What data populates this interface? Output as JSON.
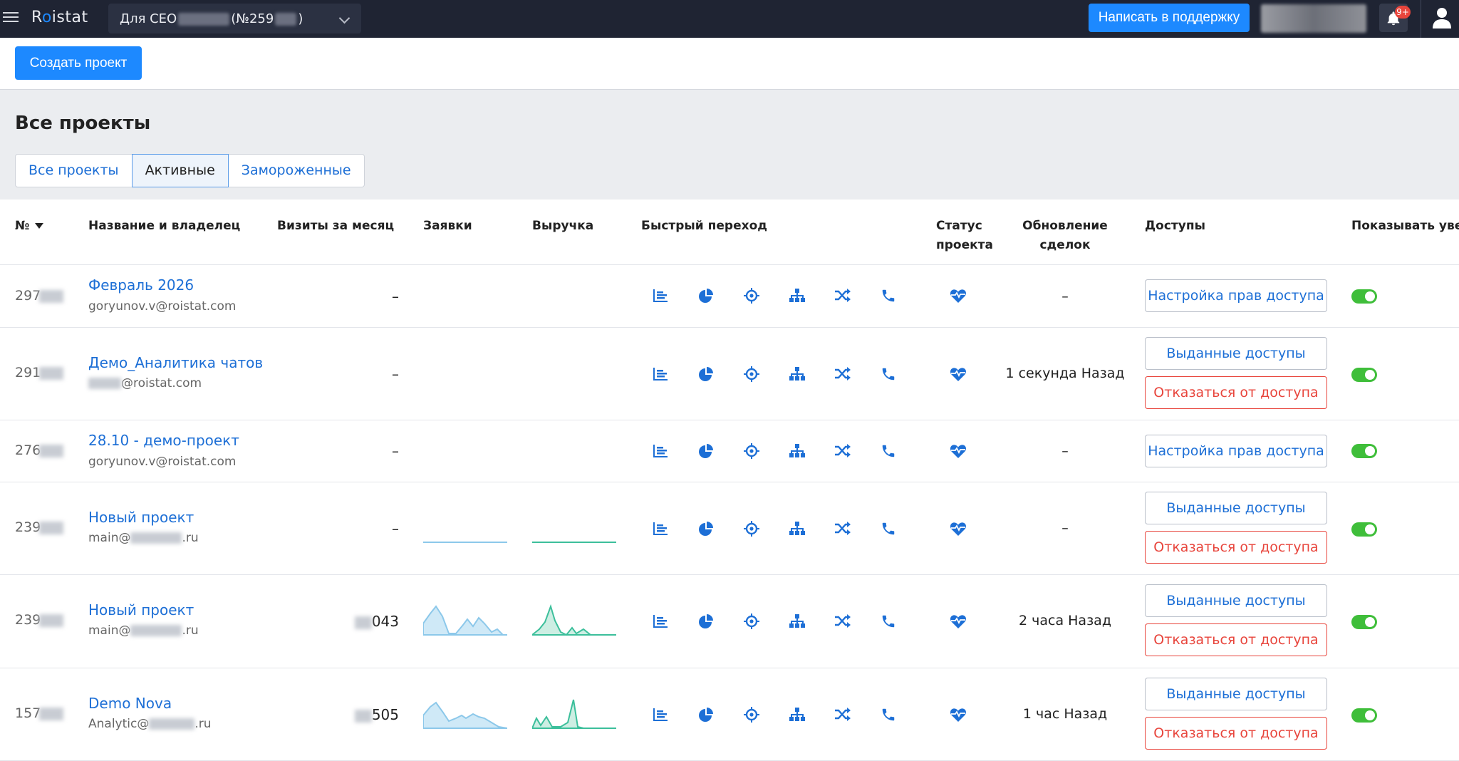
{
  "topbar": {
    "logo": "Roistat",
    "project_selector_prefix": "Для CEO",
    "project_selector_number": "(№259",
    "project_selector_suffix": ")",
    "support_button": "Написать в поддержку",
    "notifications_badge": "9+"
  },
  "toolbar": {
    "create_button": "Создать проект"
  },
  "page": {
    "title": "Все проекты",
    "tabs": [
      "Все проекты",
      "Активные",
      "Замороженные"
    ],
    "active_tab": "Активные"
  },
  "table": {
    "headers": {
      "num": "№",
      "name": "Название и владелец",
      "visits": "Визиты за месяц",
      "leads": "Заявки",
      "revenue": "Выручка",
      "quick": "Быстрый переход",
      "status_1": "Статус",
      "status_2": "проекта",
      "update_1": "Обновление",
      "update_2": "сделок",
      "access": "Доступы",
      "notify": "Показывать уведо"
    },
    "quick_icons": [
      "bar-chart-icon",
      "pie-chart-icon",
      "target-icon",
      "hierarchy-icon",
      "shuffle-icon",
      "phone-icon"
    ],
    "status_icon": "heartbeat-icon",
    "rows": [
      {
        "num": "297",
        "name": "Февраль 2026",
        "owner": "goryunov.v@roistat.com",
        "visits": "–",
        "updated": "–",
        "access_primary": "Настройка прав доступа",
        "access_secondary": "",
        "notify": true
      },
      {
        "num": "291",
        "name": "Демо_Аналитика чатов",
        "owner": "@roistat.com",
        "visits": "–",
        "updated": "1 секунда Назад",
        "access_primary": "Выданные доступы",
        "access_secondary": "Отказаться от доступа",
        "notify": true
      },
      {
        "num": "276",
        "name": "28.10 - демо-проект",
        "owner": "goryunov.v@roistat.com",
        "visits": "–",
        "updated": "–",
        "access_primary": "Настройка прав доступа",
        "access_secondary": "",
        "notify": true
      },
      {
        "num": "239",
        "name": "Новый проект",
        "owner_prefix": "main@",
        "owner_suffix": ".ru",
        "visits": "–",
        "updated": "–",
        "access_primary": "Выданные доступы",
        "access_secondary": "Отказаться от доступа",
        "notify": true
      },
      {
        "num": "239",
        "name": "Новый проект",
        "owner_prefix": "main@",
        "owner_suffix": ".ru",
        "visits": "043",
        "updated": "2 часа Назад",
        "access_primary": "Выданные доступы",
        "access_secondary": "Отказаться от доступа",
        "notify": true
      },
      {
        "num": "157",
        "name": "Demo Nova",
        "owner_prefix": "Analytic@",
        "owner_suffix": ".ru",
        "visits": "505",
        "updated": "1 час Назад",
        "access_primary": "Выданные доступы",
        "access_secondary": "Отказаться от доступа",
        "notify": true
      }
    ]
  },
  "colors": {
    "accent": "#1d89ff",
    "link": "#1d6fd6",
    "danger": "#e8453c",
    "toggle_on": "#3fbe3a",
    "topbar": "#1f2433"
  }
}
